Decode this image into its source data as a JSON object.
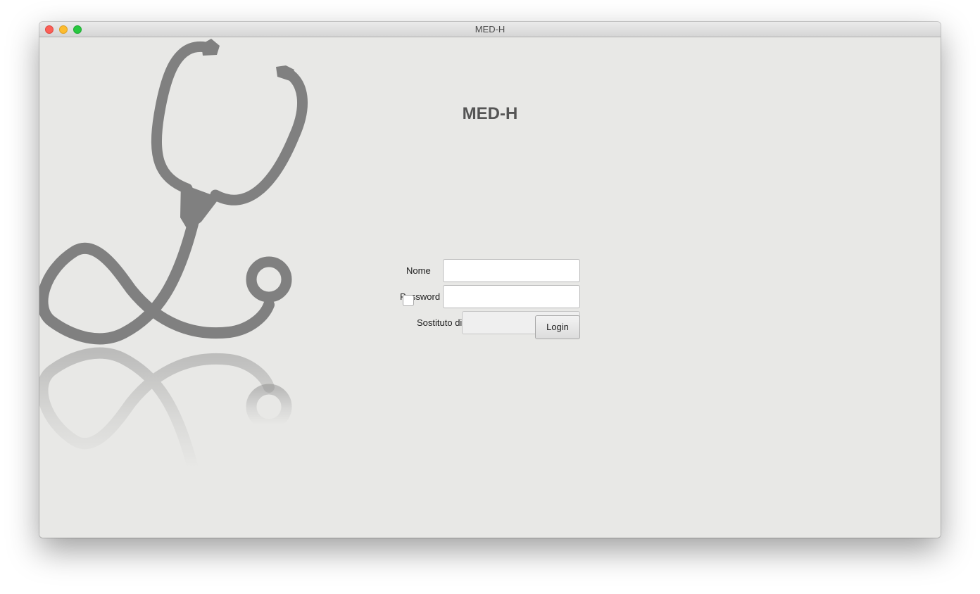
{
  "window": {
    "title": "MED-H"
  },
  "app": {
    "title": "MED-H",
    "logo_icon": "stethoscope-icon"
  },
  "form": {
    "nome_label": "Nome",
    "nome_value": "",
    "password_label": "Password",
    "password_value": "",
    "sostituto_label": "Sostituto di",
    "sostituto_checked": false,
    "sostituto_value": "",
    "login_label": "Login"
  },
  "colors": {
    "background": "#e8e8e6",
    "stethoscope": "#808080",
    "title": "#555555",
    "close": "#fc5f57",
    "minimize": "#fdbc2e",
    "zoom": "#28c840"
  }
}
